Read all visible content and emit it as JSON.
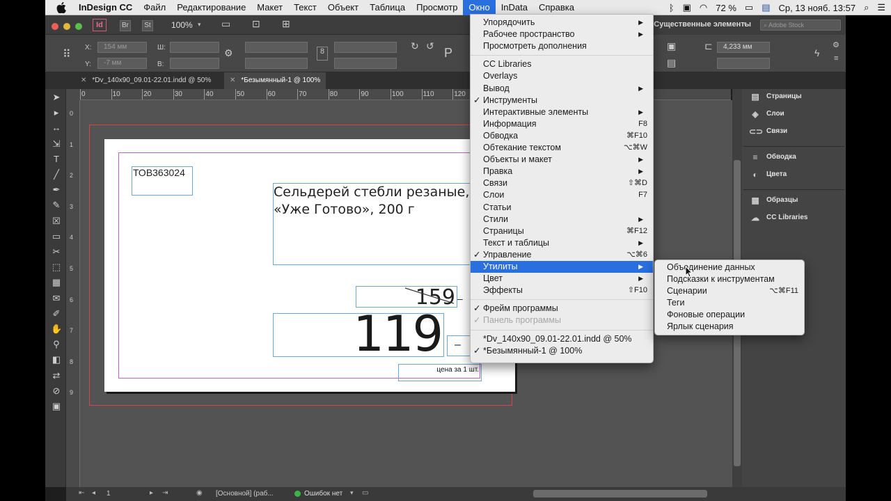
{
  "menubar": {
    "app_name": "InDesign CC",
    "items": [
      "Файл",
      "Редактирование",
      "Макет",
      "Текст",
      "Объект",
      "Таблица",
      "Просмотр",
      "Окно",
      "InData",
      "Справка"
    ],
    "active_item": "Окно",
    "battery": "72 %",
    "datetime": "Ср, 13 нояб. 13:57"
  },
  "appbar": {
    "zoom": "100%",
    "workspace": "Существенные элементы",
    "search_placeholder": "Adobe Stock",
    "logo": "Id",
    "br": "Br",
    "st": "St"
  },
  "control": {
    "x_label": "X:",
    "x_value": "154 мм",
    "y_label": "Y:",
    "y_value": "-7 мм",
    "w_label": "Ш:",
    "h_label": "В:",
    "stroke_value": "4,233 мм"
  },
  "tabs": [
    {
      "label": "*Dv_140x90_09.01-22.01.indd @ 50%",
      "active": false
    },
    {
      "label": "*Безымянный-1 @ 100%",
      "active": true
    }
  ],
  "ruler": {
    "h_ticks": [
      "0",
      "10",
      "20",
      "30",
      "40",
      "50",
      "60",
      "70",
      "80",
      "90",
      "100",
      "110",
      "120"
    ],
    "v_ticks": [
      "0",
      "1",
      "2",
      "3",
      "4",
      "5",
      "6",
      "7",
      "8",
      "9"
    ]
  },
  "document": {
    "code": "ТОВ363024",
    "product_line1": "Сельдерей стебли резаные,",
    "product_line2": "«Уже Готово», 200 г",
    "old_price": "159",
    "price": "119",
    "unit_note": "цена за 1 шт."
  },
  "window_menu": {
    "items": [
      {
        "label": "Упорядочить",
        "arrow": true
      },
      {
        "label": "Рабочее пространство",
        "arrow": true
      },
      {
        "label": "Просмотреть дополнения"
      },
      {
        "sep": true
      },
      {
        "label": "CC Libraries"
      },
      {
        "label": "Overlays"
      },
      {
        "label": "Вывод",
        "arrow": true
      },
      {
        "label": "Инструменты",
        "checked": true
      },
      {
        "label": "Интерактивные элементы",
        "arrow": true
      },
      {
        "label": "Информация",
        "shortcut": "F8"
      },
      {
        "label": "Обводка",
        "shortcut": "⌘F10"
      },
      {
        "label": "Обтекание текстом",
        "shortcut": "⌥⌘W"
      },
      {
        "label": "Объекты и макет",
        "arrow": true
      },
      {
        "label": "Правка",
        "arrow": true
      },
      {
        "label": "Связи",
        "shortcut": "⇧⌘D"
      },
      {
        "label": "Слои",
        "shortcut": "F7"
      },
      {
        "label": "Статьи"
      },
      {
        "label": "Стили",
        "arrow": true
      },
      {
        "label": "Страницы",
        "shortcut": "⌘F12"
      },
      {
        "label": "Текст и таблицы",
        "arrow": true
      },
      {
        "label": "Управление",
        "checked": true,
        "shortcut": "⌥⌘6"
      },
      {
        "label": "Утилиты",
        "arrow": true,
        "highlighted": true
      },
      {
        "label": "Цвет",
        "arrow": true
      },
      {
        "label": "Эффекты",
        "shortcut": "⇧F10"
      },
      {
        "sep": true
      },
      {
        "label": "Фрейм программы",
        "checked": true
      },
      {
        "label": "Панель программы",
        "checked": true,
        "disabled": true
      },
      {
        "sep": true
      },
      {
        "label": "*Dv_140x90_09.01-22.01.indd @ 50%"
      },
      {
        "label": "*Безымянный-1 @ 100%",
        "checked": true
      }
    ]
  },
  "utilities_submenu": {
    "items": [
      {
        "label": "Объединение данных"
      },
      {
        "label": "Подсказки к инструментам"
      },
      {
        "label": "Сценарии",
        "shortcut": "⌥⌘F11"
      },
      {
        "label": "Теги"
      },
      {
        "label": "Фоновые операции"
      },
      {
        "label": "Ярлык сценария"
      }
    ]
  },
  "panels": {
    "items": [
      "Страницы",
      "Слои",
      "Связи",
      "Обводка",
      "Цвета",
      "Образцы",
      "CC Libraries"
    ]
  },
  "statusbar": {
    "page": "1",
    "style": "[Основной] (раб...",
    "errors": "Ошибок нет"
  },
  "colors": {
    "menu_highlight": "#2a6fe0",
    "bleed": "#d64545",
    "margin": "#c064c0",
    "frame": "#6aa8d8"
  }
}
